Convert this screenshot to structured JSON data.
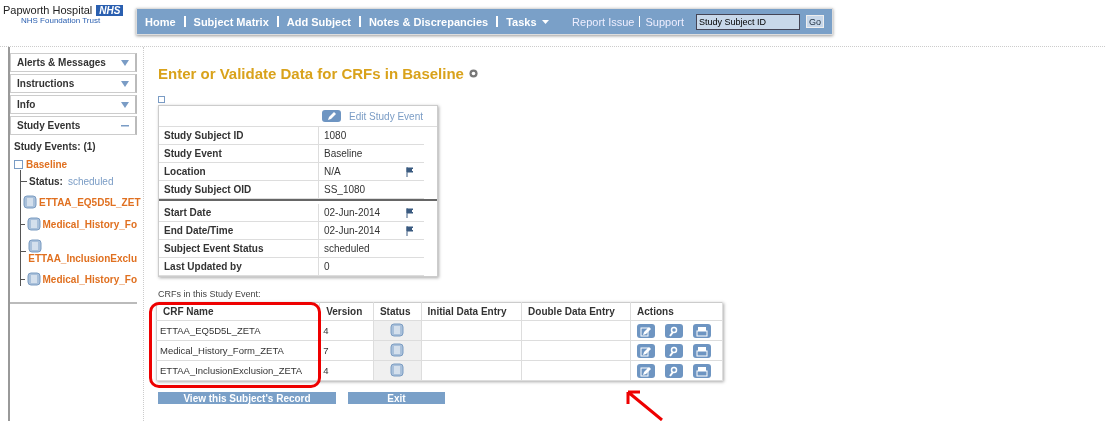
{
  "logo": {
    "name": "Papworth Hospital",
    "badge": "NHS",
    "subtitle": "NHS Foundation Trust"
  },
  "nav": {
    "items": [
      {
        "label": "Home"
      },
      {
        "label": "Subject Matrix"
      },
      {
        "label": "Add Subject"
      },
      {
        "label": "Notes & Discrepancies"
      },
      {
        "label": "Tasks",
        "dropdown": true
      }
    ],
    "links": [
      "Report Issue",
      "Support"
    ],
    "search": {
      "value": "Study Subject ID"
    },
    "go": "Go"
  },
  "sidebar": {
    "panels": [
      {
        "title": "Alerts & Messages",
        "expanded": false
      },
      {
        "title": "Instructions",
        "expanded": false
      },
      {
        "title": "Info",
        "expanded": false
      },
      {
        "title": "Study Events",
        "expanded": true
      }
    ],
    "events_heading": "Study Events: (1)",
    "event": {
      "label": "Baseline",
      "status_label": "Status:",
      "status": "scheduled",
      "forms": [
        {
          "label": "ETTAA_EQ5D5L_ZET",
          "wrapped": false
        },
        {
          "label": "Medical_History_Fo",
          "wrapped": false
        },
        {
          "label": "ETTAA_InclusionExclu",
          "wrapped": true
        },
        {
          "label": "Medical_History_Fo",
          "wrapped": false
        }
      ]
    }
  },
  "title": "Enter or Validate Data for CRFs in Baseline",
  "event_box": {
    "edit_link": "Edit Study Event",
    "sections": [
      [
        {
          "label": "Study Subject ID",
          "value": "1080",
          "flag": false
        },
        {
          "label": "Study Event",
          "value": "Baseline",
          "flag": false
        },
        {
          "label": "Location",
          "value": "N/A",
          "flag": true
        },
        {
          "label": "Study Subject OID",
          "value": "SS_1080",
          "flag": false
        }
      ],
      [
        {
          "label": "Start Date",
          "value": "02-Jun-2014",
          "flag": true
        },
        {
          "label": "End Date/Time",
          "value": "02-Jun-2014",
          "flag": true
        },
        {
          "label": "Subject Event Status",
          "value": "scheduled",
          "flag": false
        },
        {
          "label": "Last Updated by",
          "value": "0",
          "flag": false
        }
      ]
    ]
  },
  "crf_caption": "CRFs in this Study Event:",
  "crf_table": {
    "columns": [
      "CRF Name",
      "Version",
      "Status",
      "Initial Data Entry",
      "Double Data Entry",
      "Actions"
    ],
    "rows": [
      {
        "name": "ETTAA_EQ5D5L_ZETA",
        "version": "4"
      },
      {
        "name": "Medical_History_Form_ZETA",
        "version": "7"
      },
      {
        "name": "ETTAA_InclusionExclusion_ZETA",
        "version": "4"
      }
    ]
  },
  "buttons": [
    "View this Subject's Record",
    "Exit"
  ]
}
